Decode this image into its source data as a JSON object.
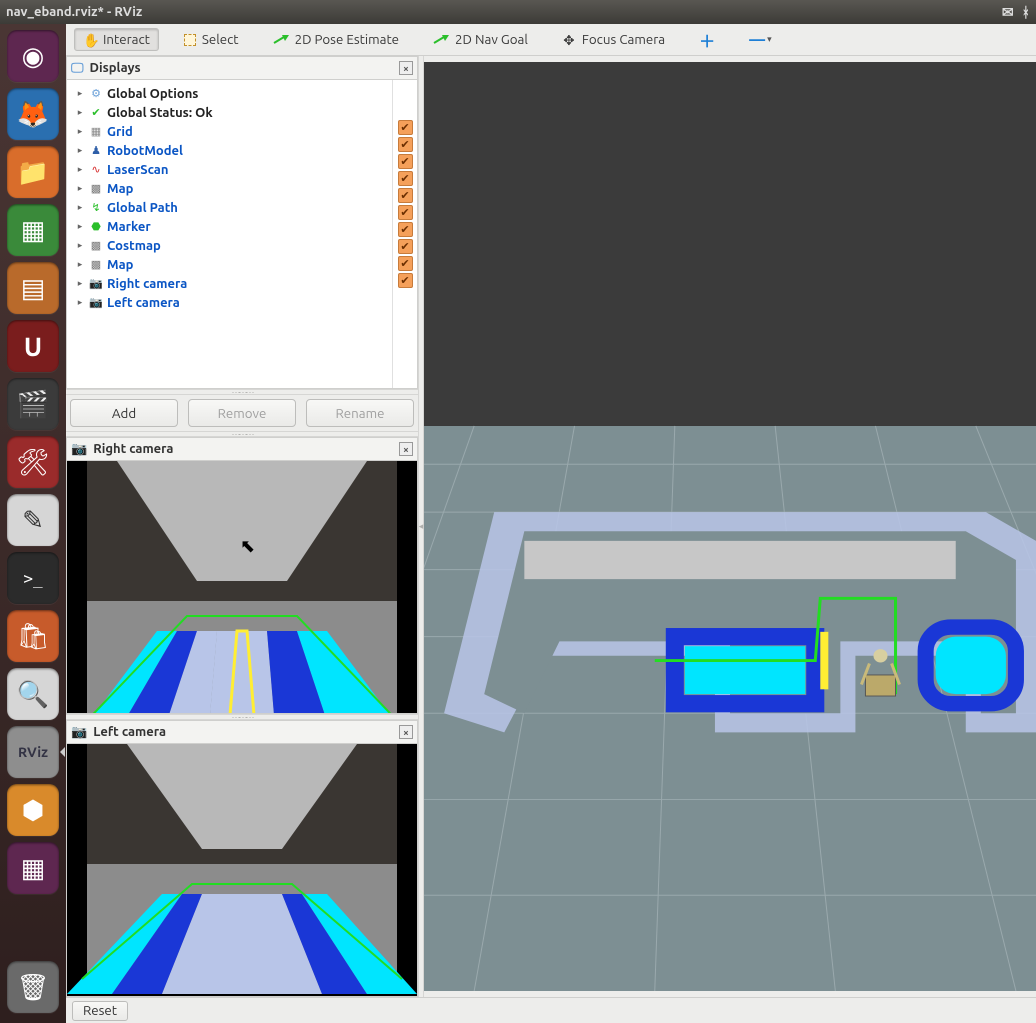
{
  "window": {
    "title": "nav_eband.rviz* - RViz"
  },
  "toolbar": {
    "interact": "Interact",
    "select": "Select",
    "pose_estimate": "2D Pose Estimate",
    "nav_goal": "2D Nav Goal",
    "focus_camera": "Focus Camera"
  },
  "panels": {
    "displays": {
      "title": "Displays",
      "items": [
        {
          "label": "Global Options",
          "link": false,
          "icon": "gear",
          "checked": null
        },
        {
          "label": "Global Status: Ok",
          "link": false,
          "icon": "check",
          "checked": null
        },
        {
          "label": "Grid",
          "link": true,
          "icon": "grid",
          "checked": true
        },
        {
          "label": "RobotModel",
          "link": true,
          "icon": "robot",
          "checked": true
        },
        {
          "label": "LaserScan",
          "link": true,
          "icon": "laser",
          "checked": true
        },
        {
          "label": "Map",
          "link": true,
          "icon": "map",
          "checked": true
        },
        {
          "label": "Global Path",
          "link": true,
          "icon": "path",
          "checked": true
        },
        {
          "label": "Marker",
          "link": true,
          "icon": "marker",
          "checked": true
        },
        {
          "label": "Costmap",
          "link": true,
          "icon": "map",
          "checked": true
        },
        {
          "label": "Map",
          "link": true,
          "icon": "map",
          "checked": true
        },
        {
          "label": "Right camera",
          "link": true,
          "icon": "camera",
          "checked": true
        },
        {
          "label": "Left camera",
          "link": true,
          "icon": "camera",
          "checked": true
        }
      ],
      "buttons": {
        "add": "Add",
        "remove": "Remove",
        "rename": "Rename"
      }
    },
    "right_camera": {
      "title": "Right camera"
    },
    "left_camera": {
      "title": "Left camera"
    }
  },
  "footer": {
    "reset": "Reset"
  },
  "launcher": [
    {
      "name": "dash",
      "bg": "#5e2750",
      "glyph": "◉"
    },
    {
      "name": "firefox",
      "bg": "#2a6fb0",
      "glyph": "🦊"
    },
    {
      "name": "files",
      "bg": "#a35a2a",
      "glyph": "📁"
    },
    {
      "name": "calc",
      "bg": "#3a8a3a",
      "glyph": "📊"
    },
    {
      "name": "impress",
      "bg": "#b96a2b",
      "glyph": "📽"
    },
    {
      "name": "ubuntu-one",
      "bg": "#7a1d1d",
      "glyph": "U"
    },
    {
      "name": "video",
      "bg": "#3b3b3b",
      "glyph": "🎬"
    },
    {
      "name": "settings",
      "bg": "#9a2b2b",
      "glyph": "🛠"
    },
    {
      "name": "gedit",
      "bg": "#d6d6d6",
      "glyph": "📝"
    },
    {
      "name": "terminal",
      "bg": "#2b2b2b",
      "glyph": ">_"
    },
    {
      "name": "software",
      "bg": "#c75b2b",
      "glyph": "🛍"
    },
    {
      "name": "search",
      "bg": "#d6d6d6",
      "glyph": "🔍"
    },
    {
      "name": "rviz",
      "bg": "#7a7a7a",
      "glyph": "R"
    },
    {
      "name": "gazebo",
      "bg": "#5a5a5a",
      "glyph": "📦"
    },
    {
      "name": "workspace",
      "bg": "#5e2750",
      "glyph": "▦"
    }
  ],
  "colors": {
    "accent": "#dd4814",
    "link": "#0a55c4",
    "grid_bg_top": "#3b3b3b",
    "grid_bg_floor": "#7d8f93",
    "costmap_cyan": "#00e5ff",
    "costmap_blue": "#1a37d6",
    "costmap_light": "#b8c5e8",
    "path_green": "#22dd22",
    "lane_yellow": "#ffee33"
  }
}
